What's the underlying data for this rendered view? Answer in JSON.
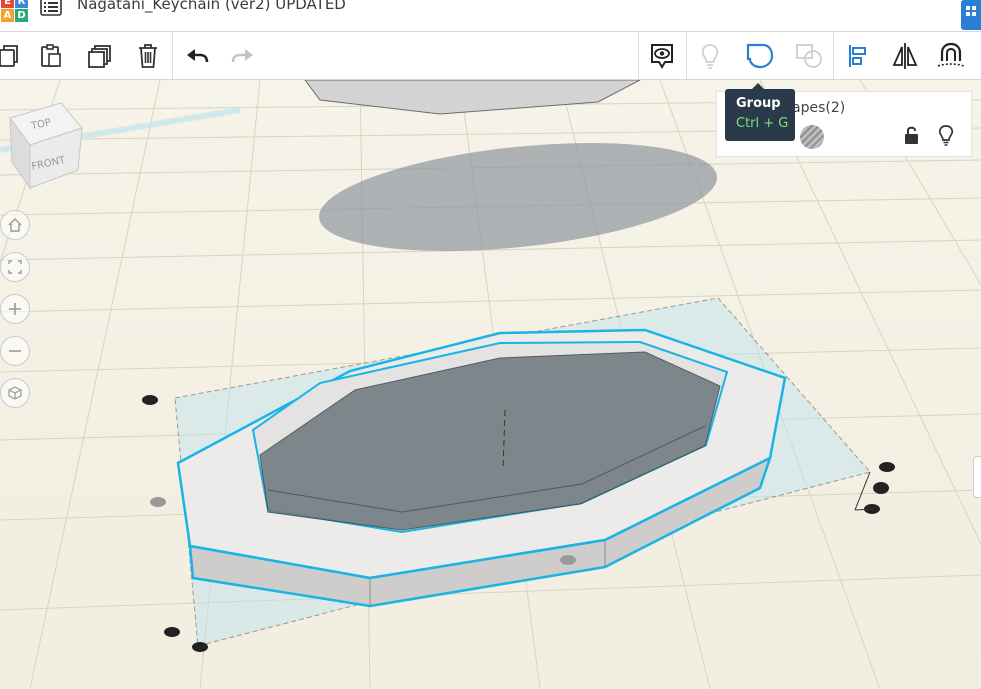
{
  "app": {
    "logo_letters": [
      "E",
      "R",
      "A",
      "D"
    ],
    "document_title": "Nagatani_Keychain (ver2) UPDATED",
    "brand_colors": {
      "logo_tiles": [
        "#e8463a",
        "#3b87d8",
        "#f2a12b",
        "#2aa876"
      ],
      "accent_blue": "#2a7fd4",
      "selection_cyan": "#19b4e4"
    }
  },
  "toolbar": {
    "left_icons": [
      "copy-icon",
      "paste-icon",
      "duplicate-icon",
      "delete-icon",
      "undo-icon",
      "redo-icon"
    ],
    "right_icons": [
      "show-all-icon",
      "bulb-icon",
      "group-icon",
      "ungroup-icon",
      "align-icon",
      "mirror-icon",
      "workplane-magnet-icon"
    ]
  },
  "tooltip": {
    "title": "Group",
    "shortcut": "Ctrl + G"
  },
  "shape_panel": {
    "label": "apes(2)",
    "icons": [
      "hole-swatch",
      "lock-open-icon",
      "bulb-icon"
    ]
  },
  "viewcube": {
    "top_label": "TOP",
    "front_label": "FRONT"
  },
  "nav_buttons": [
    "home-icon",
    "fit-icon",
    "zoom-in-icon",
    "zoom-out-icon",
    "perspective-icon"
  ]
}
